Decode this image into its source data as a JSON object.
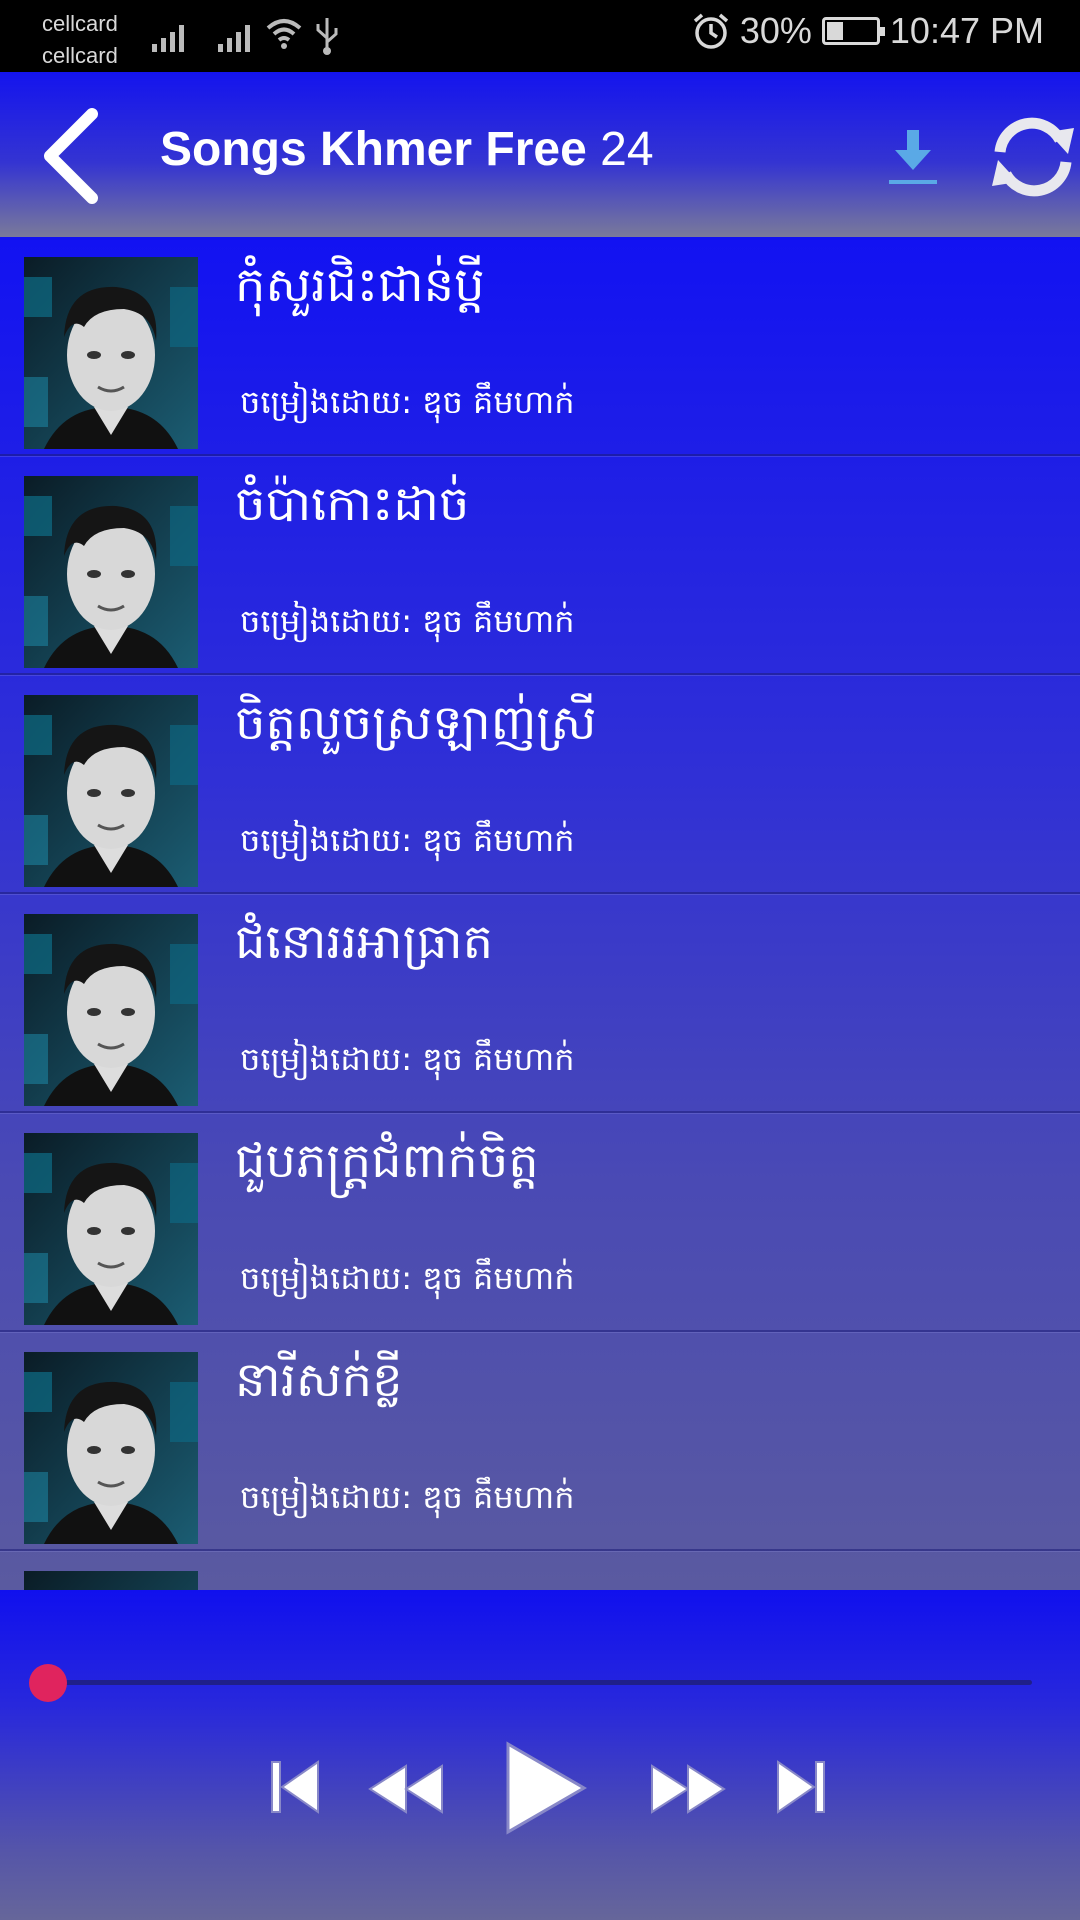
{
  "status_bar": {
    "carrier_1": "cellcard",
    "carrier_2": "cellcard",
    "battery_text": "30%",
    "battery_level": 0.3,
    "time": "10:47 PM"
  },
  "header": {
    "title_bold": "Songs Khmer Free",
    "title_number": "24",
    "icons": [
      "back-arrow-icon",
      "download-icon",
      "refresh-icon"
    ]
  },
  "songs": [
    {
      "title": "កុំសួរជិះជាន់ប្តី",
      "artist": "ចម្រៀងដោយ: ឌុច គឹមហាក់"
    },
    {
      "title": "ចំប៉ាកោះដាច់",
      "artist": "ចម្រៀងដោយ: ឌុច គឹមហាក់"
    },
    {
      "title": "ចិត្តលួចស្រឡាញ់ស្រី",
      "artist": "ចម្រៀងដោយ: ឌុច គឹមហាក់"
    },
    {
      "title": "ជំនោររអាធ្រាត",
      "artist": "ចម្រៀងដោយ: ឌុច គឹមហាក់"
    },
    {
      "title": "ជួបភក្រ្តជំពាក់ចិត្ត",
      "artist": "ចម្រៀងដោយ: ឌុច គឹមហាក់"
    },
    {
      "title": "នារីសក់ខ្លី",
      "artist": "ចម្រៀងដោយ: ឌុច គឹមហាក់"
    },
    {
      "title": "",
      "artist": ""
    }
  ],
  "player": {
    "progress": 0.0,
    "accent_color": "#e0245e",
    "controls": [
      "skip-previous-icon",
      "rewind-icon",
      "play-icon",
      "fast-forward-icon",
      "skip-next-icon"
    ]
  }
}
